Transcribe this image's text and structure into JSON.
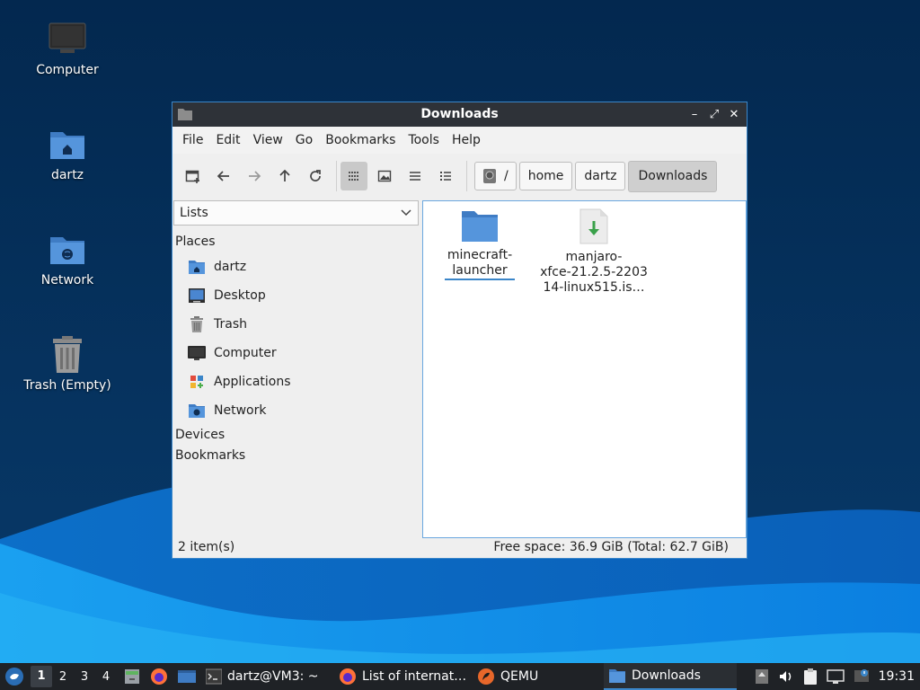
{
  "desktop": {
    "icons": [
      {
        "label": "Computer"
      },
      {
        "label": "dartz"
      },
      {
        "label": "Network"
      },
      {
        "label": "Trash (Empty)"
      }
    ]
  },
  "window": {
    "title": "Downloads",
    "controls": {
      "minimize": "–",
      "maximize": "⤢",
      "close": "✕"
    },
    "menu": [
      "File",
      "Edit",
      "View",
      "Go",
      "Bookmarks",
      "Tools",
      "Help"
    ],
    "toolbar": {
      "buttons": [
        "new-tab-icon",
        "back-arrow-icon",
        "forward-arrow-icon",
        "up-arrow-icon",
        "reload-icon",
        "icon-view-icon",
        "thumbnail-view-icon",
        "compact-list-icon",
        "detailed-list-icon"
      ],
      "active_view": "icon-view-icon"
    },
    "breadcrumbs": {
      "root": "/",
      "items": [
        "home",
        "dartz",
        "Downloads"
      ]
    },
    "sidepane": {
      "mode": "Lists",
      "sections": {
        "places": "Places",
        "devices": "Devices",
        "bookmarks": "Bookmarks"
      },
      "places": [
        {
          "label": "dartz",
          "icon": "home-folder-icon"
        },
        {
          "label": "Desktop",
          "icon": "desktop-icon"
        },
        {
          "label": "Trash",
          "icon": "trash-icon"
        },
        {
          "label": "Computer",
          "icon": "computer-icon"
        },
        {
          "label": "Applications",
          "icon": "applications-icon"
        },
        {
          "label": "Network",
          "icon": "network-icon"
        }
      ]
    },
    "files": [
      {
        "name_line1": "minecraft-",
        "name_line2": "launcher",
        "name_line3": "",
        "icon": "folder-icon",
        "selected": true
      },
      {
        "name_line1": "manjaro-",
        "name_line2": "xfce-21.2.5-2203",
        "name_line3": "14-linux515.is…",
        "icon": "iso-download-icon",
        "selected": false
      }
    ],
    "status": {
      "count": "2 item(s)",
      "free_space": "Free space: 36.9 GiB (Total: 62.7 GiB)"
    }
  },
  "taskbar": {
    "workspaces": [
      "1",
      "2",
      "3",
      "4"
    ],
    "active_workspace": "1",
    "tasks": [
      {
        "label": "dartz@VM3: ~",
        "icon": "terminal-icon"
      },
      {
        "label": "List of internat…",
        "icon": "firefox-icon"
      },
      {
        "label": "QEMU",
        "icon": "qemu-icon"
      },
      {
        "label": "Downloads",
        "icon": "folder-icon",
        "active": true
      }
    ],
    "clock": "19:31"
  },
  "colors": {
    "accent": "#3b86c9",
    "titlebar": "#2e3238",
    "taskbar": "#1f2226",
    "folder": "#4a86d0"
  }
}
